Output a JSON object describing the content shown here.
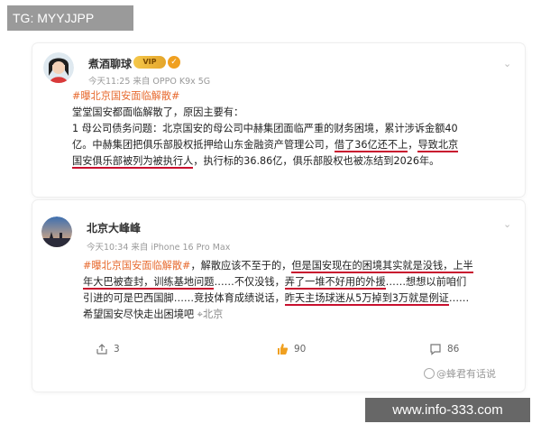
{
  "tag": {
    "label": "TG: MYYJJPP"
  },
  "post1": {
    "username": "煮酒聊球",
    "vip_badge": "VIP",
    "meta": "今天11:25 来自 OPPO K9x 5G",
    "topic": "#曝北京国安面临解散#",
    "line1": "堂堂国安都面临解散了，原因主要有：",
    "line2": "1  母公司债务问题：北京国安的母公司中赫集团面临严重的财务困境，累计涉诉金额40",
    "line3": "亿。中赫集团把俱乐部股权抵押给山东金融资产管理公司，",
    "line3_u1": "借了36亿还不上",
    "line3_mid": "，",
    "line3_u2": "导致北京",
    "line4_u": "国安俱乐部被列为被执行人",
    "line4_rest": "，执行标的36.86亿，俱乐部股权也被冻结到2026年。"
  },
  "post2": {
    "username": "北京大峰峰",
    "meta": "今天10:34 来自 iPhone 16 Pro Max",
    "topic": "#曝北京国安面临解散#",
    "l1_a": "，解散应该不至于的，",
    "l1_u": "但是国安现在的困境其实就是没钱，上半",
    "l2_u1": "年大巴被查封，训练基地问题",
    "l2_b": "……不仅没钱，",
    "l2_u2": "弄了一堆不好用的外援",
    "l2_c": "……想想以前咱们",
    "l3_a": "引进的可是巴西国脚……竞技体育成绩说话，",
    "l3_u": "昨天主场球迷从5万掉到3万就是例证",
    "l3_b": "……",
    "l4": "希望国安尽快走出困境吧",
    "location": "北京",
    "share_count": "3",
    "like_count": "90",
    "comment_count": "86"
  },
  "footer": {
    "credit": "@蜂君有话说"
  },
  "watermark": {
    "text": "www.info-333.com"
  },
  "colors": {
    "underline": "#c8102e",
    "topic": "#e76a2f",
    "like": "#f0a020"
  }
}
